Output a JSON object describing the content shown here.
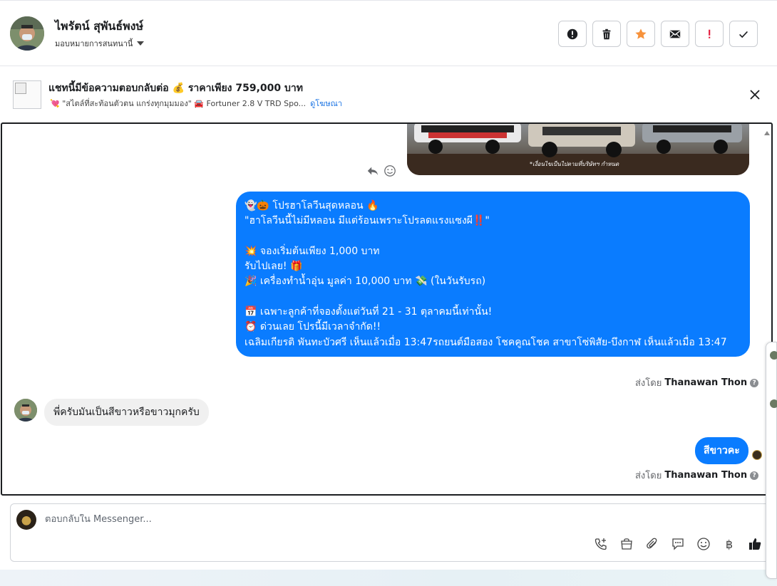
{
  "header": {
    "contact_name": "ไพรัตน์ สุพันธ์พงษ์",
    "assign_label": "มอบหมายการสนทนานี้"
  },
  "actions": [
    {
      "name": "report-spam-button",
      "icon": "alert-circle-icon"
    },
    {
      "name": "delete-button",
      "icon": "trash-icon"
    },
    {
      "name": "star-button",
      "icon": "star-icon"
    },
    {
      "name": "mark-unread-button",
      "icon": "envelope-icon"
    },
    {
      "name": "mark-important-button",
      "icon": "exclamation-icon"
    },
    {
      "name": "mark-done-button",
      "icon": "check-icon"
    }
  ],
  "ad": {
    "title": "แชทนี้มีข้อความตอบกลับต่อ 💰 ราคาเพียง 759,000 บาท",
    "subtitle": "💘 \"สไตล์ที่สะท้อนตัวตน แกร่งทุกมุมมอง\" 🚘 Fortuner 2.8 V TRD Spo...",
    "link": "ดูโฆษณา"
  },
  "image": {
    "caption": "*เงื่อนไขเป็นไปตามที่บริษัทฯ กำหนด"
  },
  "messages": {
    "promo_lines": [
      "👻🎃 โปรฮาโลวีนสุดหลอน 🔥",
      "\"ฮาโลวีนนี้ไม่มีหลอน มีแต่ร้อนเพราะโปรลดแรงแซงผี‼️\"",
      "",
      "💥 จองเริ่มต้นเพียง 1,000 บาท",
      "รับไปเลย! 🎁",
      "🎉 เครื่องทำน้ำอุ่น มูลค่า 10,000 บาท 💸 (ในวันรับรถ)",
      "",
      "📅 เฉพาะลูกค้าที่จองตั้งแต่วันที่ 21 - 31 ตุลาคมนี้เท่านั้น!",
      "⏰ ด่วนเลย โปรนี้มีเวลาจำกัด!!",
      "เฉลิมเกียรติ พันทะบัวศรี เห็นแล้วเมื่อ 13:47รถยนต์มือสอง โชคคูณโชค สาขาโซ่พิสัย-บึงกาฬ เห็นแล้วเมื่อ 13:47"
    ],
    "sent_by_prefix": "ส่งโดย",
    "sender": "Thanawan Thon",
    "customer_message": "พี่ครับมันเป็นสีขาวหรือขาวมุกครับ",
    "reply_message": "สีขาวคะ"
  },
  "composer": {
    "placeholder": "ตอบกลับใน Messenger..."
  },
  "tools": [
    {
      "name": "call-icon"
    },
    {
      "name": "shop-bag-icon"
    },
    {
      "name": "attach-icon"
    },
    {
      "name": "saved-reply-icon"
    },
    {
      "name": "emoji-icon"
    },
    {
      "name": "baht-icon",
      "glyph": "฿"
    },
    {
      "name": "like-icon"
    }
  ],
  "colors": {
    "accent": "#0a7cff",
    "star": "#f7923b",
    "exclaim": "#e41e3f"
  }
}
